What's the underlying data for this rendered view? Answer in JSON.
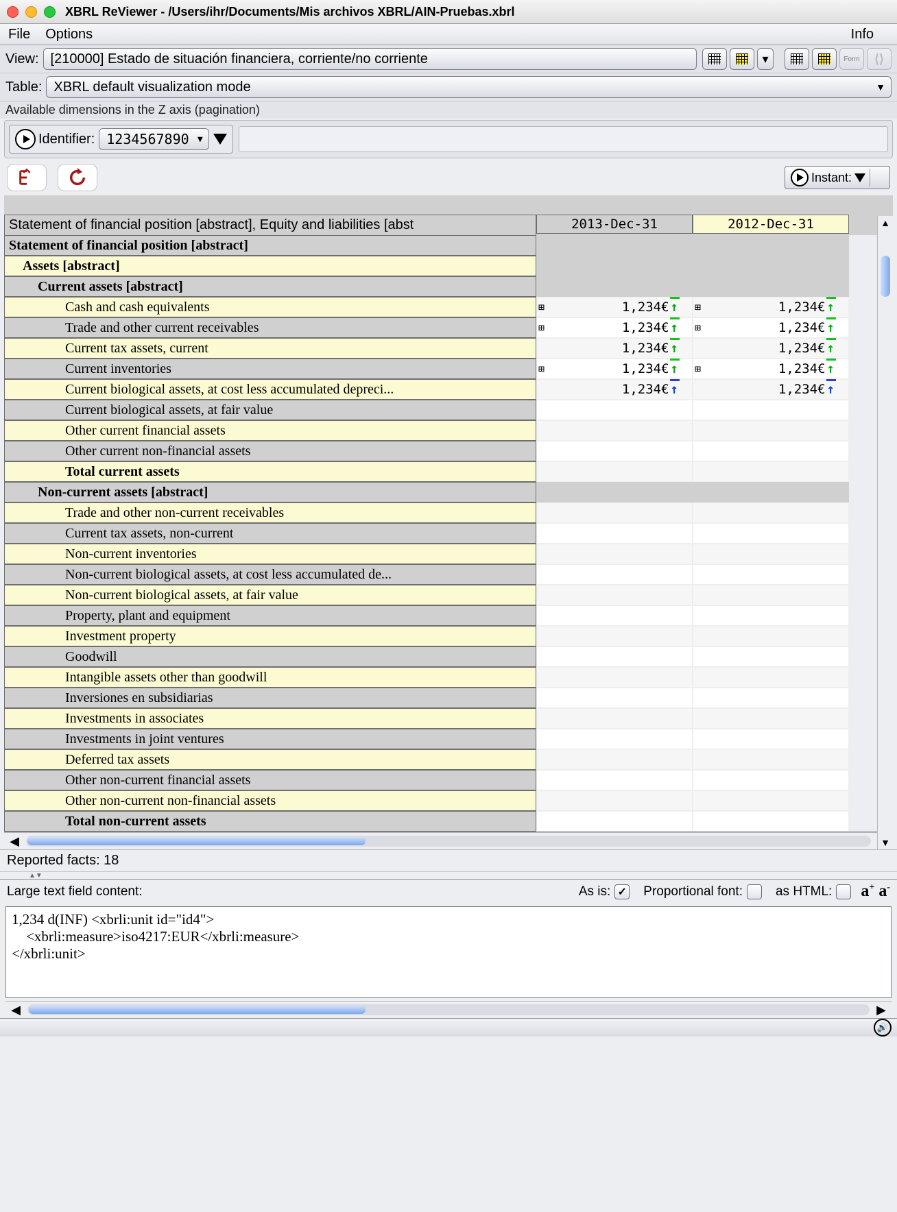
{
  "window": {
    "title": "XBRL ReViewer - /Users/ihr/Documents/Mis archivos XBRL/AIN-Pruebas.xbrl"
  },
  "menu": {
    "file": "File",
    "options": "Options",
    "info": "Info"
  },
  "view": {
    "label": "View:",
    "value": "[210000] Estado de situación financiera, corriente/no corriente"
  },
  "table": {
    "label": "Table:",
    "value": "XBRL default visualization mode"
  },
  "zaxis": {
    "caption": "Available dimensions in the Z axis (pagination)",
    "identifier_label": "Identifier:",
    "identifier_value": "1234567890"
  },
  "instant": {
    "label": "Instant:"
  },
  "columns": [
    "2013-Dec-31",
    "2012-Dec-31"
  ],
  "lefthdr": "Statement of financial position [abstract], Equity and liabilities [abst",
  "rows": [
    {
      "label": "Statement of financial position [abstract]",
      "bold": true,
      "bg": "g",
      "indent": 0,
      "header": true
    },
    {
      "label": "Assets [abstract]",
      "bold": true,
      "bg": "y",
      "indent": 1,
      "header": true
    },
    {
      "label": "Current assets [abstract]",
      "bold": true,
      "bg": "g",
      "indent": 2,
      "header": true
    },
    {
      "label": "Cash and cash equivalents",
      "bg": "y",
      "indent": 3,
      "v1": "1,234€",
      "v2": "1,234€",
      "calc": true,
      "arrow": "g"
    },
    {
      "label": "Trade and other current receivables",
      "bg": "g",
      "indent": 3,
      "v1": "1,234€",
      "v2": "1,234€",
      "calc": true,
      "arrow": "g"
    },
    {
      "label": "Current tax assets, current",
      "bg": "y",
      "indent": 3,
      "v1": "1,234€",
      "v2": "1,234€",
      "arrow": "g"
    },
    {
      "label": "Current inventories",
      "bg": "g",
      "indent": 3,
      "v1": "1,234€",
      "v2": "1,234€",
      "calc": true,
      "arrow": "g"
    },
    {
      "label": "Current biological assets, at cost less accumulated depreci...",
      "bg": "y",
      "indent": 3,
      "v1": "1,234€",
      "v2": "1,234€",
      "arrow": "b"
    },
    {
      "label": "Current biological assets, at fair value",
      "bg": "g",
      "indent": 3,
      "empty": true
    },
    {
      "label": "Other current financial assets",
      "bg": "y",
      "indent": 3,
      "empty": true
    },
    {
      "label": "Other current non-financial assets",
      "bg": "g",
      "indent": 3,
      "empty": true
    },
    {
      "label": "Total current assets",
      "bold": true,
      "bg": "y",
      "indent": 3,
      "empty": true
    },
    {
      "label": "Non-current assets [abstract]",
      "bold": true,
      "bg": "g",
      "indent": 2,
      "header": true
    },
    {
      "label": "Trade and other non-current receivables",
      "bg": "y",
      "indent": 3,
      "empty": true
    },
    {
      "label": "Current tax assets, non-current",
      "bg": "g",
      "indent": 3,
      "empty": true
    },
    {
      "label": "Non-current inventories",
      "bg": "y",
      "indent": 3,
      "empty": true
    },
    {
      "label": "Non-current biological assets, at cost less accumulated de...",
      "bg": "g",
      "indent": 3,
      "empty": true
    },
    {
      "label": "Non-current biological assets, at fair value",
      "bg": "y",
      "indent": 3,
      "empty": true
    },
    {
      "label": "Property, plant and equipment",
      "bg": "g",
      "indent": 3,
      "empty": true
    },
    {
      "label": "Investment property",
      "bg": "y",
      "indent": 3,
      "empty": true
    },
    {
      "label": "Goodwill",
      "bg": "g",
      "indent": 3,
      "empty": true
    },
    {
      "label": "Intangible assets other than goodwill",
      "bg": "y",
      "indent": 3,
      "empty": true
    },
    {
      "label": "Inversiones en subsidiarias",
      "bg": "g",
      "indent": 3,
      "empty": true
    },
    {
      "label": "Investments in associates",
      "bg": "y",
      "indent": 3,
      "empty": true
    },
    {
      "label": "Investments in joint ventures",
      "bg": "g",
      "indent": 3,
      "empty": true
    },
    {
      "label": "Deferred tax assets",
      "bg": "y",
      "indent": 3,
      "empty": true
    },
    {
      "label": "Other non-current financial assets",
      "bg": "g",
      "indent": 3,
      "empty": true
    },
    {
      "label": "Other non-current non-financial assets",
      "bg": "y",
      "indent": 3,
      "empty": true
    },
    {
      "label": "Total non-current assets",
      "bold": true,
      "bg": "g",
      "indent": 3,
      "empty": true
    }
  ],
  "status": {
    "reported": "Reported facts: 18"
  },
  "bottom": {
    "large_label": "Large text field content:",
    "asis": "As is:",
    "propfont": "Proportional font:",
    "ashtml": "as HTML:"
  },
  "textarea": "1,234 d(INF) <xbrli:unit id=\"id4\">\n    <xbrli:measure>iso4217:EUR</xbrli:measure>\n</xbrli:unit>"
}
